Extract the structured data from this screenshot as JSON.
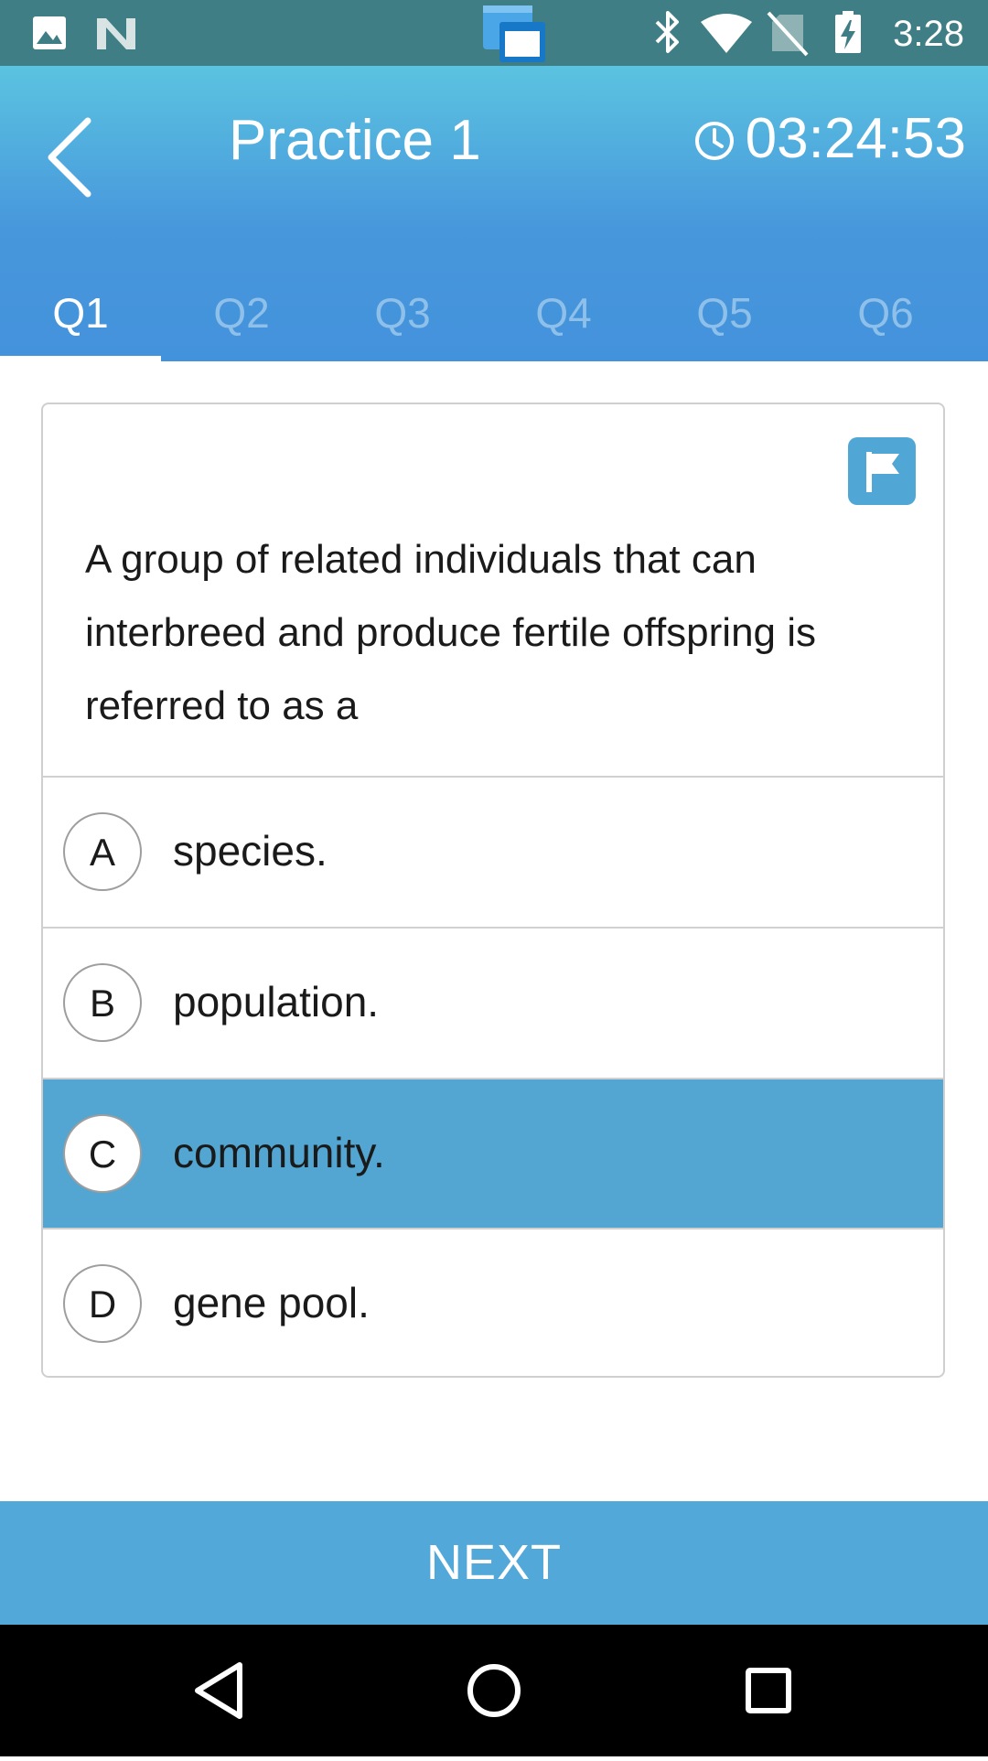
{
  "status_bar": {
    "time": "3:28",
    "left_icons": [
      "image-icon",
      "n-logo-icon"
    ],
    "center_icon": "window-switcher-icon",
    "right_icons": [
      "bluetooth-icon",
      "wifi-icon",
      "no-sim-icon",
      "battery-charging-icon"
    ]
  },
  "header": {
    "title": "Practice 1",
    "timer": "03:24:53",
    "back_icon": "chevron-left-icon",
    "clock_icon": "clock-icon"
  },
  "tabs": [
    {
      "label": "Q1",
      "active": true
    },
    {
      "label": "Q2",
      "active": false
    },
    {
      "label": "Q3",
      "active": false
    },
    {
      "label": "Q4",
      "active": false
    },
    {
      "label": "Q5",
      "active": false
    },
    {
      "label": "Q6",
      "active": false
    }
  ],
  "question": {
    "text": "A group of related individuals that can interbreed and produce fertile offspring is referred to as a",
    "flag_icon": "flag-icon",
    "options": [
      {
        "letter": "A",
        "text": "species.",
        "selected": false
      },
      {
        "letter": "B",
        "text": "population.",
        "selected": false
      },
      {
        "letter": "C",
        "text": "community.",
        "selected": true
      },
      {
        "letter": "D",
        "text": "gene pool.",
        "selected": false
      }
    ]
  },
  "next_button": {
    "label": "NEXT"
  },
  "nav_bar": {
    "icons": [
      "back-triangle-icon",
      "home-circle-icon",
      "recents-square-icon"
    ]
  },
  "colors": {
    "header_top": "#5bc3e0",
    "header_bottom": "#4392dc",
    "selected_option": "#52a6d1",
    "next_button": "#52a8d8",
    "status_bar": "#3f7e84"
  }
}
